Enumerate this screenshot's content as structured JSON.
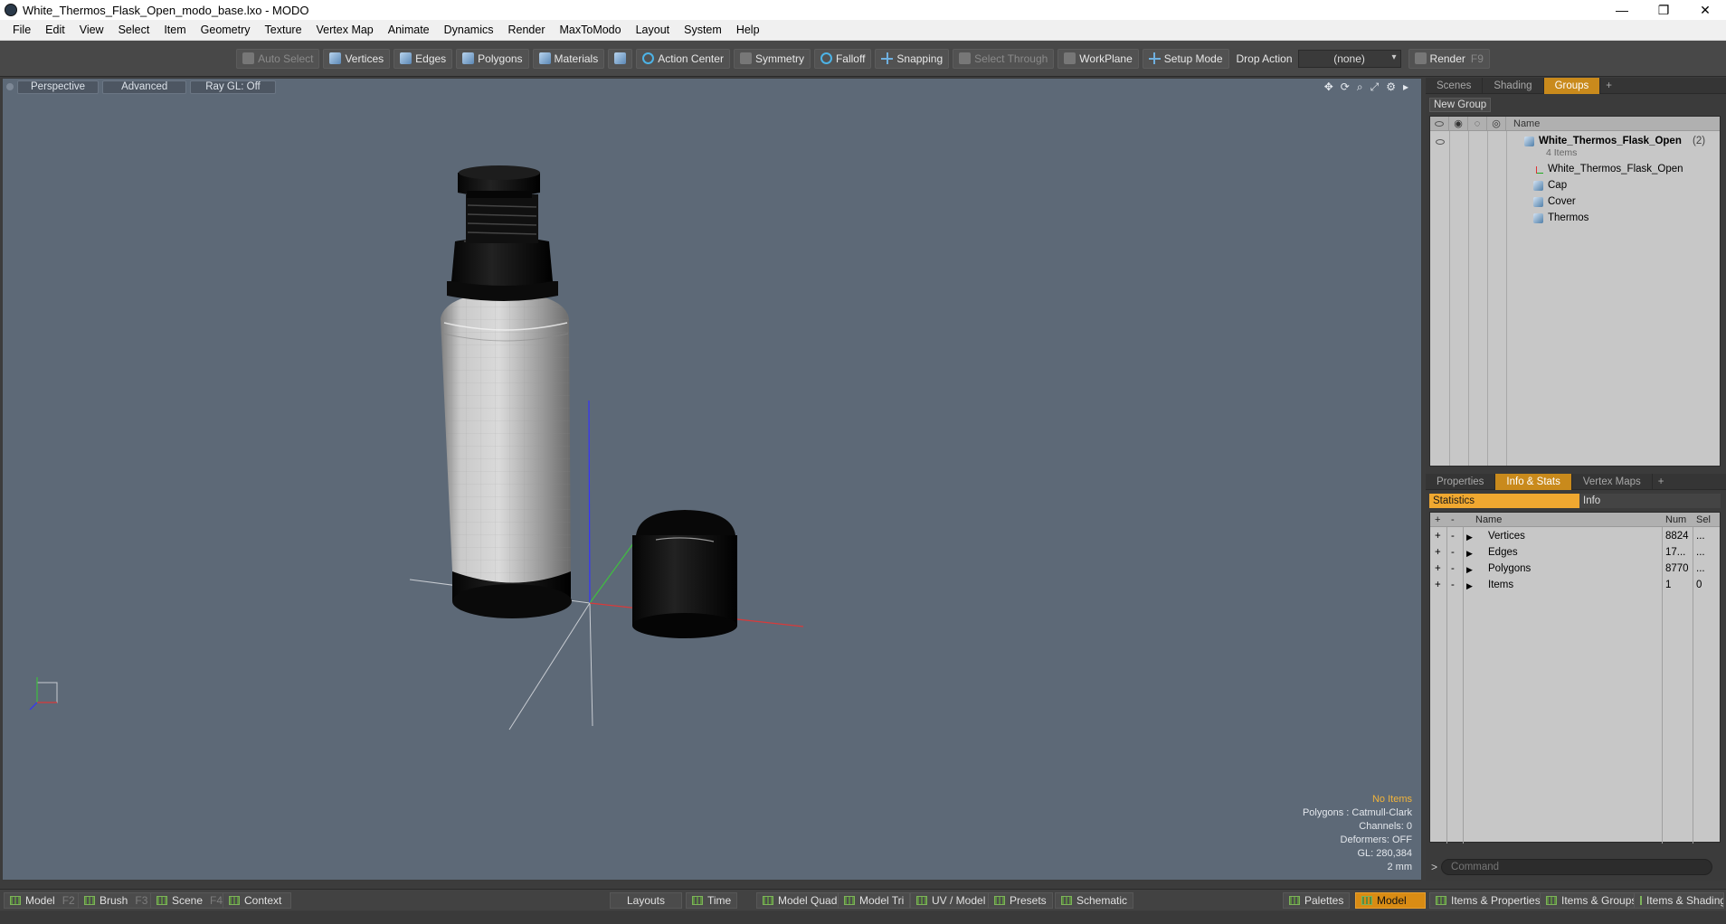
{
  "window": {
    "title": "White_Thermos_Flask_Open_modo_base.lxo - MODO",
    "controls": [
      "—",
      "❐",
      "✕"
    ]
  },
  "menu": [
    "File",
    "Edit",
    "View",
    "Select",
    "Item",
    "Geometry",
    "Texture",
    "Vertex Map",
    "Animate",
    "Dynamics",
    "Render",
    "MaxToModo",
    "Layout",
    "System",
    "Help"
  ],
  "toolbar": {
    "auto_select": "Auto Select",
    "vertices": "Vertices",
    "edges": "Edges",
    "polygons": "Polygons",
    "materials": "Materials",
    "action_center": "Action Center",
    "symmetry": "Symmetry",
    "falloff": "Falloff",
    "snapping": "Snapping",
    "select_through": "Select Through",
    "workplane": "WorkPlane",
    "setup_mode": "Setup Mode",
    "drop_action_label": "Drop Action",
    "drop_action_value": "(none)",
    "render": "Render",
    "render_key": "F9"
  },
  "viewport": {
    "tabs": [
      "Perspective",
      "Advanced",
      "Ray GL: Off"
    ],
    "nav_icons": [
      "✥",
      "⟳",
      "⌕",
      "⤢",
      "⚙",
      "▸"
    ],
    "stats": {
      "selection": "No Items",
      "polygons": "Polygons : Catmull-Clark",
      "channels": "Channels: 0",
      "deformers": "Deformers: OFF",
      "gl": "GL: 280,384",
      "scale": "2 mm"
    }
  },
  "groups_panel": {
    "tabs": [
      "Scenes",
      "Shading",
      "Groups",
      "+"
    ],
    "active_tab": "Groups",
    "new_group": "New Group",
    "column_name": "Name",
    "root": {
      "name": "White_Thermos_Flask_Open",
      "count": "(2)",
      "subtitle": "4 Items"
    },
    "children": [
      "White_Thermos_Flask_Open",
      "Cap",
      "Cover",
      "Thermos"
    ]
  },
  "stats_panel": {
    "tabs": [
      "Properties",
      "Info & Stats",
      "Vertex Maps",
      "+"
    ],
    "active_tab": "Info & Stats",
    "subtabs": [
      "Statistics",
      "Info"
    ],
    "columns": {
      "name": "Name",
      "num": "Num",
      "sel": "Sel"
    },
    "rows": [
      {
        "name": "Vertices",
        "num": "8824",
        "sel": "..."
      },
      {
        "name": "Edges",
        "num": "17...",
        "sel": "..."
      },
      {
        "name": "Polygons",
        "num": "8770",
        "sel": "..."
      },
      {
        "name": "Items",
        "num": "1",
        "sel": "0"
      }
    ]
  },
  "command": {
    "prompt": ">",
    "placeholder": "Command"
  },
  "bottom_bar": {
    "left": [
      {
        "label": "Model",
        "key": "F2"
      },
      {
        "label": "Brush",
        "key": "F3"
      },
      {
        "label": "Scene",
        "key": "F4"
      },
      {
        "label": "Context",
        "key": ""
      }
    ],
    "center": [
      "Layouts",
      "Time",
      "Model Quad",
      "Model Tri",
      "UV / Model",
      "Presets",
      "Schematic"
    ],
    "right": [
      "Palettes",
      "Model",
      "Items & Properties",
      "Items & Groups",
      "Items & Shading"
    ],
    "active": "Model"
  },
  "colors": {
    "accent_orange": "#d98c14",
    "viewport_bg": "#5d6977",
    "axis_x": "#d93a3a",
    "axis_y": "#3fbf3f",
    "axis_z": "#3333ff"
  }
}
